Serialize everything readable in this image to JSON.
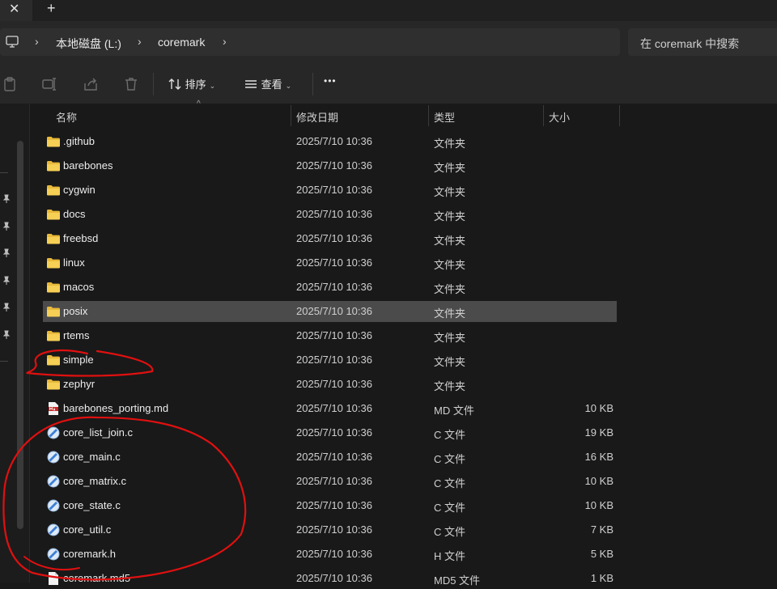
{
  "tabs": {
    "close_glyph": "✕",
    "new_glyph": "+"
  },
  "address": {
    "breadcrumbs": [
      "本地磁盘 (L:)",
      "coremark"
    ],
    "search_placeholder": "在 coremark 中搜索"
  },
  "toolbar": {
    "sort_label": "排序",
    "view_label": "查看",
    "more_label": "•••"
  },
  "columns": {
    "name": "名称",
    "date": "修改日期",
    "type": "类型",
    "size": "大小"
  },
  "files": [
    {
      "name": ".github",
      "date": "2025/7/10 10:36",
      "type": "文件夹",
      "size": "",
      "icon": "folder-icon"
    },
    {
      "name": "barebones",
      "date": "2025/7/10 10:36",
      "type": "文件夹",
      "size": "",
      "icon": "folder-icon"
    },
    {
      "name": "cygwin",
      "date": "2025/7/10 10:36",
      "type": "文件夹",
      "size": "",
      "icon": "folder-icon"
    },
    {
      "name": "docs",
      "date": "2025/7/10 10:36",
      "type": "文件夹",
      "size": "",
      "icon": "folder-icon"
    },
    {
      "name": "freebsd",
      "date": "2025/7/10 10:36",
      "type": "文件夹",
      "size": "",
      "icon": "folder-icon"
    },
    {
      "name": "linux",
      "date": "2025/7/10 10:36",
      "type": "文件夹",
      "size": "",
      "icon": "folder-icon"
    },
    {
      "name": "macos",
      "date": "2025/7/10 10:36",
      "type": "文件夹",
      "size": "",
      "icon": "folder-icon"
    },
    {
      "name": "posix",
      "date": "2025/7/10 10:36",
      "type": "文件夹",
      "size": "",
      "icon": "folder-icon",
      "selected": true
    },
    {
      "name": "rtems",
      "date": "2025/7/10 10:36",
      "type": "文件夹",
      "size": "",
      "icon": "folder-icon"
    },
    {
      "name": "simple",
      "date": "2025/7/10 10:36",
      "type": "文件夹",
      "size": "",
      "icon": "folder-icon"
    },
    {
      "name": "zephyr",
      "date": "2025/7/10 10:36",
      "type": "文件夹",
      "size": "",
      "icon": "folder-icon"
    },
    {
      "name": "barebones_porting.md",
      "date": "2025/7/10 10:36",
      "type": "MD 文件",
      "size": "10 KB",
      "icon": "markdown-file-icon"
    },
    {
      "name": "core_list_join.c",
      "date": "2025/7/10 10:36",
      "type": "C 文件",
      "size": "19 KB",
      "icon": "c-file-icon"
    },
    {
      "name": "core_main.c",
      "date": "2025/7/10 10:36",
      "type": "C 文件",
      "size": "16 KB",
      "icon": "c-file-icon"
    },
    {
      "name": "core_matrix.c",
      "date": "2025/7/10 10:36",
      "type": "C 文件",
      "size": "10 KB",
      "icon": "c-file-icon"
    },
    {
      "name": "core_state.c",
      "date": "2025/7/10 10:36",
      "type": "C 文件",
      "size": "10 KB",
      "icon": "c-file-icon"
    },
    {
      "name": "core_util.c",
      "date": "2025/7/10 10:36",
      "type": "C 文件",
      "size": "7 KB",
      "icon": "c-file-icon"
    },
    {
      "name": "coremark.h",
      "date": "2025/7/10 10:36",
      "type": "H 文件",
      "size": "5 KB",
      "icon": "c-file-icon"
    },
    {
      "name": "coremark.md5",
      "date": "2025/7/10 10:36",
      "type": "MD5 文件",
      "size": "1 KB",
      "icon": "generic-file-icon"
    }
  ],
  "colors": {
    "selection": "#4b4b4b",
    "folder": "#f4c542",
    "annotation": "#e01010"
  }
}
